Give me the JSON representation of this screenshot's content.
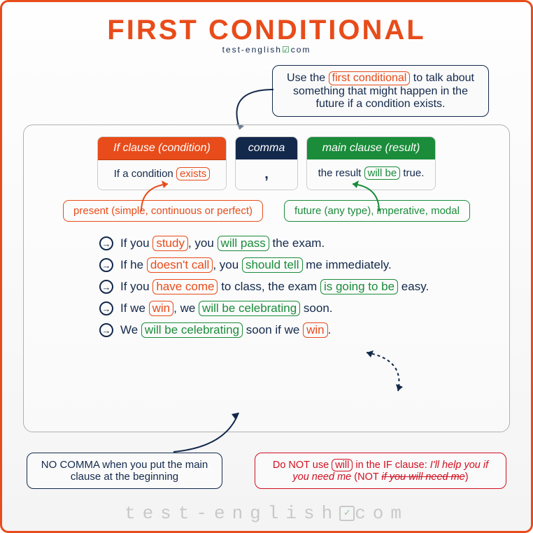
{
  "title": "FIRST CONDITIONAL",
  "brand": "test-english",
  "brand_suffix": "com",
  "intro": {
    "pre": "Use the ",
    "chip": "first conditional",
    "post": " to talk about something that might happen in the future if a condition exists."
  },
  "clauses": {
    "if": {
      "head": "If clause (condition)",
      "body_pre": "If a condition ",
      "chip": "exists"
    },
    "comma": {
      "head": "comma",
      "body": ","
    },
    "main": {
      "head": "main clause (result)",
      "body_pre": "the result ",
      "chip": "will be",
      "body_post": " true."
    }
  },
  "tenses": {
    "left": "present (simple, continuous or perfect)",
    "right": "future (any type), imperative, modal"
  },
  "examples": [
    {
      "parts": [
        "If you ",
        {
          "t": "study",
          "c": "o"
        },
        ", you ",
        {
          "t": "will pass",
          "c": "g"
        },
        " the exam."
      ]
    },
    {
      "parts": [
        "If he ",
        {
          "t": "doesn't call",
          "c": "o"
        },
        ", you ",
        {
          "t": "should tell",
          "c": "g"
        },
        " me immediately."
      ]
    },
    {
      "parts": [
        "If you ",
        {
          "t": "have come",
          "c": "o"
        },
        " to class, the exam ",
        {
          "t": "is going to be",
          "c": "g"
        },
        " easy."
      ]
    },
    {
      "parts": [
        "If we ",
        {
          "t": "win",
          "c": "o"
        },
        ", we ",
        {
          "t": "will be celebrating",
          "c": "g"
        },
        " soon."
      ]
    },
    {
      "parts": [
        "We ",
        {
          "t": "will be celebrating",
          "c": "g"
        },
        " soon if we ",
        {
          "t": "win",
          "c": "o"
        },
        "."
      ]
    }
  ],
  "note_left": "NO COMMA when you put the main clause at the beginning",
  "note_right": {
    "pre": "Do NOT use ",
    "chip": "will",
    "mid": " in the IF clause: ",
    "ok": "I'll help you if you need me",
    "not_label": " (NOT ",
    "bad": "if you will need me",
    "close": ")"
  },
  "footer": "test-english",
  "footer_suffix": "com"
}
